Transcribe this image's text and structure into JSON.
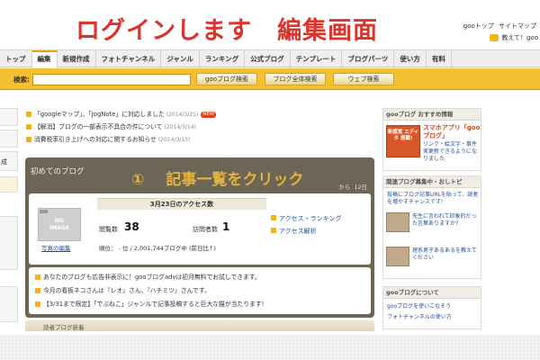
{
  "banner": {
    "title_main": "ログインします",
    "title_sub": "編集画面",
    "top_links": [
      "gooトップ",
      "サイトマップ"
    ],
    "user_text": "教えて！goo"
  },
  "nav": {
    "tabs": [
      "トップ",
      "編集",
      "新規作成",
      "フォトチャンネル",
      "ジャンル",
      "ランキング",
      "公式ブログ",
      "テンプレート",
      "ブログパーツ",
      "使い方",
      "有料"
    ],
    "active_index": 1
  },
  "search": {
    "label": "検索:",
    "input_value": "",
    "buttons": [
      "gooブログ検索",
      "ブログ全体検索",
      "ウェブ検索"
    ]
  },
  "left_sidebar": {
    "stub_text": "成"
  },
  "notices": [
    {
      "text": "「googleマップ」、「JogNote」に対応しました",
      "date": "(2014/3/25)",
      "new": "NEW"
    },
    {
      "text": "【解消】ブログの一部表示不具合の件について",
      "date": "(2014/3/14)",
      "new": ""
    },
    {
      "text": "消費税率引き上げへの対応に関するお知らせ",
      "date": "(2014/3/13)",
      "new": ""
    }
  ],
  "panel": {
    "title": "初めてのブログ",
    "instruction_num": "①",
    "instruction_text": "記事一覧をクリック",
    "since_text": "から",
    "days": "12日",
    "access": {
      "header": "3月23日のアクセス数",
      "no_image_line1": "NO",
      "no_image_line2": "IMAGE",
      "photo_edit": "写真の編集",
      "views_label": "閲覧数",
      "views_value": "38",
      "visitors_label": "訪問者数",
      "visitors_value": "1",
      "rank_text": "順位： - 位 / 2,001,744ブログ中 (前日比↑)",
      "links": [
        "アクセス・ランキング",
        "アクセス解析"
      ]
    },
    "info_lines": [
      "あなたのブログも広告非表示に！gooブログadvは初月無料でお試しできます。",
      "今月の看板ネコさんは『レオ』さん、『ハチミツ』さんです。",
      "【3/31まで限定】「でぶねこ」ジャンルで記事投稿すると巨大な猫が当たります!"
    ],
    "bottom_text": "読者ブログ新着"
  },
  "right_column": {
    "recommend_head": "gooブログ おすすめ情報",
    "app_thumb_text": "新感覚 エディタ 搭載!",
    "app_title": "スマホアプリ「gooブログ」",
    "app_desc": "リンク・絵文字・事件実更新できるようになりました",
    "topics_head": "関連ブログ募集中・おしトピ",
    "topics_text": "投稿にブログ記事URLを貼って、読者を増やすチャンスです!",
    "person1_text": "先生に言われて印象的だった言葉ありますか?",
    "person2_text": "理系男子あるあるを教えてください",
    "about_head": "gooブログについて",
    "about_lines": [
      "gooブログを使いこなそう",
      "フォトチャンネルの使い方"
    ]
  },
  "colors": {
    "banner_red": "#d8352c",
    "search_bar_yellow": "#f4c032",
    "panel_brown": "#6d6556",
    "instruction_gold": "#e6b33f",
    "link_blue": "#1c4ea3"
  }
}
